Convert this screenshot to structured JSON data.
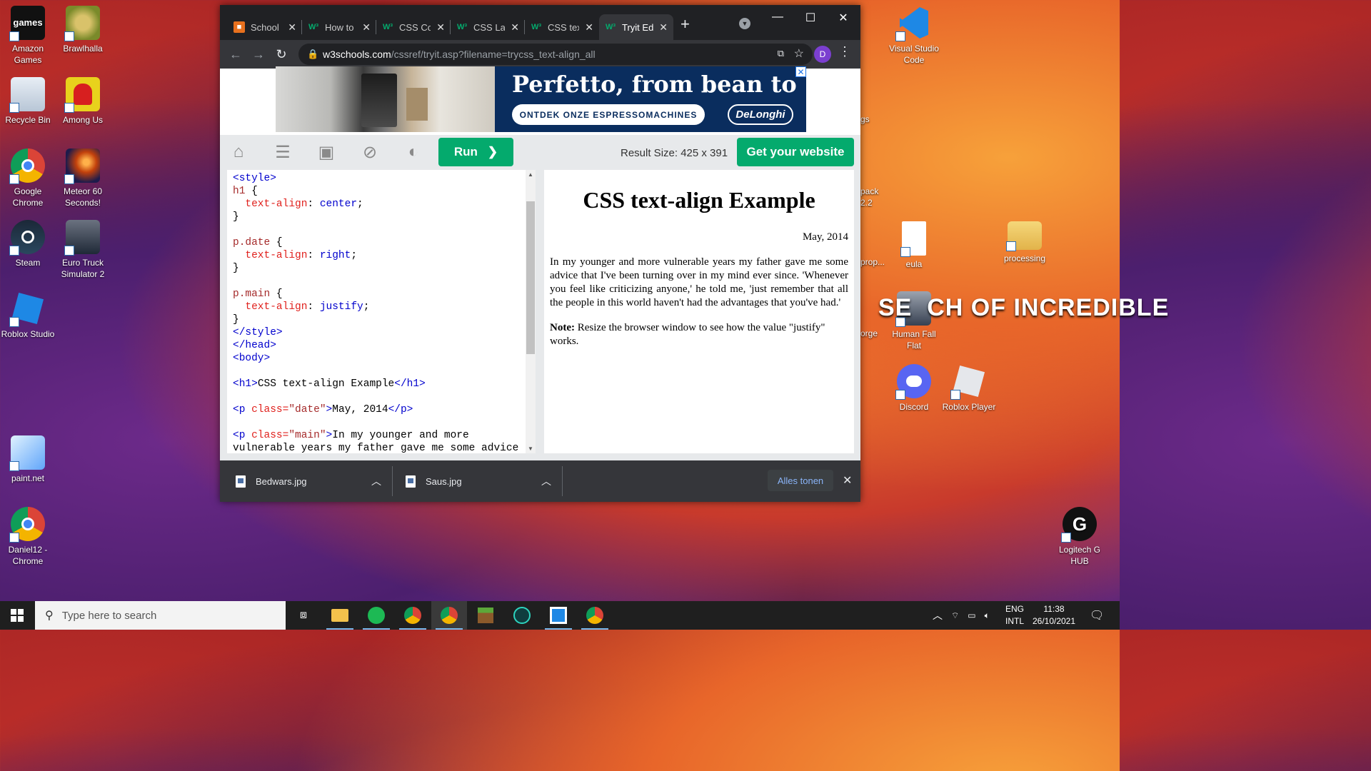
{
  "desktop": {
    "icons_left": [
      {
        "label": "Amazon Games",
        "glyph": "games"
      },
      {
        "label": "Brawlhalla",
        "glyph": ""
      },
      {
        "label": "Recycle Bin",
        "glyph": ""
      },
      {
        "label": "Among Us",
        "glyph": ""
      },
      {
        "label": "Google Chrome",
        "glyph": ""
      },
      {
        "label": "Meteor 60 Seconds!",
        "glyph": ""
      },
      {
        "label": "Steam",
        "glyph": ""
      },
      {
        "label": "Euro Truck Simulator 2",
        "glyph": ""
      },
      {
        "label": "Roblox Studio",
        "glyph": ""
      },
      {
        "label": "paint.net",
        "glyph": ""
      },
      {
        "label": "Daniel12 - Chrome",
        "glyph": "D"
      }
    ],
    "icons_right": [
      {
        "label": "Visual Studio Code"
      },
      {
        "label": "eula"
      },
      {
        "label": "processing"
      },
      {
        "label": "Human Fall Flat"
      },
      {
        "label": "Discord"
      },
      {
        "label": "Roblox Player"
      },
      {
        "label": "Logitech G HUB"
      }
    ],
    "partial_labels": [
      "gs",
      "pack 2.2",
      "prop...",
      "orge"
    ],
    "wallpaper_text": "SE  CH OF INCREDIBLE"
  },
  "browser": {
    "tabs": [
      {
        "title": "School",
        "favicon": "school"
      },
      {
        "title": "How to",
        "favicon": "w3"
      },
      {
        "title": "CSS Co",
        "favicon": "w3"
      },
      {
        "title": "CSS La",
        "favicon": "w3"
      },
      {
        "title": "CSS tex",
        "favicon": "w3"
      },
      {
        "title": "Tryit Ed",
        "favicon": "w3",
        "active": true
      }
    ],
    "url_host": "w3schools.com",
    "url_path": "/cssref/tryit.asp?filename=trycss_text-align_all",
    "profile_initial": "D",
    "ad": {
      "headline": "Perfetto, from bean to cup.",
      "cta": "ONTDEK ONZE ESPRESSOMACHINES",
      "brand": "DeLonghi"
    },
    "toolbar": {
      "run_label": "Run",
      "result_size": "Result Size: 425 x 391",
      "get_website": "Get your website"
    },
    "result": {
      "h1": "CSS text-align Example",
      "date": "May, 2014",
      "main": "In my younger and more vulnerable years my father gave me some advice that I've been turning over in my mind ever since. 'Whenever you feel like criticizing anyone,' he told me, 'just remember that all the people in this world haven't had the advantages that you've had.'",
      "note_bold": "Note:",
      "note_rest": " Resize the browser window to see how the value \"justify\" works."
    },
    "downloads": [
      {
        "name": "Bedwars.jpg"
      },
      {
        "name": "Saus.jpg"
      }
    ],
    "show_all": "Alles tonen"
  },
  "taskbar": {
    "search_placeholder": "Type here to search",
    "lang_top": "ENG",
    "lang_bottom": "INTL",
    "time": "11:38",
    "date": "26/10/2021"
  },
  "code_lines": [
    [
      [
        "tagc",
        "<style>"
      ]
    ],
    [
      [
        "sel",
        "h1"
      ],
      [
        "",
        "{"
      ]
    ],
    [
      [
        "",
        "  "
      ],
      [
        "prop",
        "text-align"
      ],
      [
        "",
        ": "
      ],
      [
        "val",
        "center"
      ],
      [
        "",
        ";"
      ]
    ],
    [
      [
        "",
        "}"
      ]
    ],
    [
      [
        "",
        ""
      ]
    ],
    [
      [
        "sel",
        "p.date"
      ],
      [
        "",
        "{"
      ]
    ],
    [
      [
        "",
        "  "
      ],
      [
        "prop",
        "text-align"
      ],
      [
        "",
        ": "
      ],
      [
        "val",
        "right"
      ],
      [
        "",
        ";"
      ]
    ],
    [
      [
        "",
        "}"
      ]
    ],
    [
      [
        "",
        ""
      ]
    ],
    [
      [
        "sel",
        "p.main"
      ],
      [
        "",
        "{"
      ]
    ],
    [
      [
        "",
        "  "
      ],
      [
        "prop",
        "text-align"
      ],
      [
        "",
        ": "
      ],
      [
        "val",
        "justify"
      ],
      [
        "",
        ";"
      ]
    ],
    [
      [
        "",
        "}"
      ]
    ],
    [
      [
        "tagc",
        "</style>"
      ]
    ],
    [
      [
        "tagc",
        "</head>"
      ]
    ],
    [
      [
        "tagc",
        "<body>"
      ]
    ],
    [
      [
        "",
        ""
      ]
    ],
    [
      [
        "tagc",
        "<h1>"
      ],
      [
        "",
        "CSS text-align Example"
      ],
      [
        "tagc",
        "</h1>"
      ]
    ],
    [
      [
        "",
        ""
      ]
    ],
    [
      [
        "tagc",
        "<p "
      ],
      [
        "attr",
        "class="
      ],
      [
        "str",
        "\"date\""
      ],
      [
        "tagc",
        ">"
      ],
      [
        "",
        "May, 2014"
      ],
      [
        "tagc",
        "</p>"
      ]
    ],
    [
      [
        "",
        ""
      ]
    ],
    [
      [
        "tagc",
        "<p "
      ],
      [
        "attr",
        "class="
      ],
      [
        "str",
        "\"main\""
      ],
      [
        "tagc",
        ">"
      ],
      [
        "",
        "In my younger and more"
      ]
    ],
    [
      [
        "",
        "vulnerable years my father gave me some advice"
      ]
    ]
  ]
}
